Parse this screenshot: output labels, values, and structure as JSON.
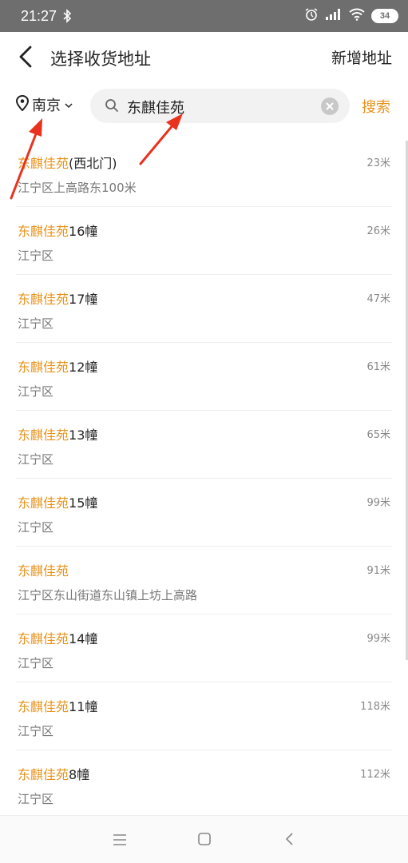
{
  "status": {
    "time": "21:27",
    "battery": "34"
  },
  "header": {
    "title": "选择收货地址",
    "add_label": "新增地址"
  },
  "search": {
    "city": "南京",
    "query": "东麒佳苑",
    "button_label": "搜索"
  },
  "colors": {
    "accent": "#e8921a",
    "annotation_arrow": "#e8321e",
    "status_bar": "#6e6e6e"
  },
  "results": [
    {
      "match": "东麒佳苑",
      "rest": "(西北门)",
      "address": "江宁区上高路东100米",
      "distance": "23米"
    },
    {
      "match": "东麒佳苑",
      "rest": "16幢",
      "address": "江宁区",
      "distance": "26米"
    },
    {
      "match": "东麒佳苑",
      "rest": "17幢",
      "address": "江宁区",
      "distance": "47米"
    },
    {
      "match": "东麒佳苑",
      "rest": "12幢",
      "address": "江宁区",
      "distance": "61米"
    },
    {
      "match": "东麒佳苑",
      "rest": "13幢",
      "address": "江宁区",
      "distance": "65米"
    },
    {
      "match": "东麒佳苑",
      "rest": "15幢",
      "address": "江宁区",
      "distance": "99米"
    },
    {
      "match": "东麒佳苑",
      "rest": "",
      "address": "江宁区东山街道东山镇上坊上高路",
      "distance": "91米"
    },
    {
      "match": "东麒佳苑",
      "rest": "14幢",
      "address": "江宁区",
      "distance": "99米"
    },
    {
      "match": "东麒佳苑",
      "rest": "11幢",
      "address": "江宁区",
      "distance": "118米"
    },
    {
      "match": "东麒佳苑",
      "rest": "8幢",
      "address": "江宁区",
      "distance": "112米"
    }
  ]
}
